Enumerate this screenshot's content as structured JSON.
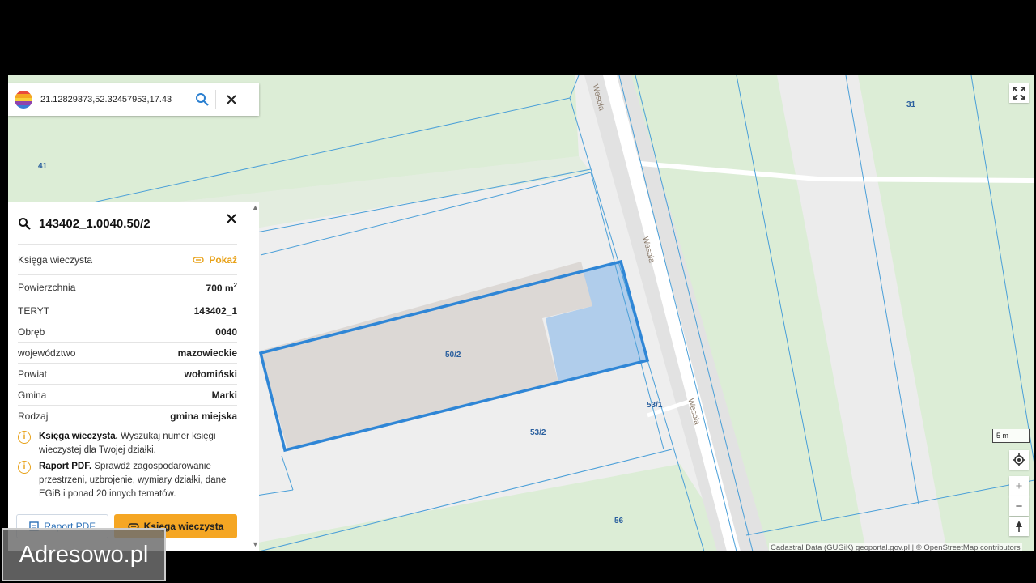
{
  "search": {
    "value": "21.12829373,52.32457953,17.43",
    "logo_icon": "adresowo-logo-icon",
    "search_icon": "search-icon",
    "clear_icon": "close-icon"
  },
  "panel": {
    "title": "143402_1.0040.50/2",
    "close_icon": "close-icon",
    "rows": [
      {
        "label": "Księga wieczysta",
        "value": "Pokaż",
        "is_link": true
      },
      {
        "label": "Powierzchnia",
        "value": "700 m",
        "sup": "2"
      },
      {
        "label": "TERYT",
        "value": "143402_1"
      },
      {
        "label": "Obręb",
        "value": "0040"
      },
      {
        "label": "województwo",
        "value": "mazowieckie"
      },
      {
        "label": "Powiat",
        "value": "wołomiński"
      },
      {
        "label": "Gmina",
        "value": "Marki"
      },
      {
        "label": "Rodzaj",
        "value": "gmina miejska"
      }
    ],
    "notes": [
      {
        "title": "Księga wieczysta.",
        "text": "Wyszukaj numer księgi wieczystej dla Twojej działki."
      },
      {
        "title": "Raport PDF.",
        "text": "Sprawdź zagospodarowanie przestrzeni, uzbrojenie, wymiary działki, dane EGiB i ponad 20 innych tematów."
      }
    ],
    "btn_report": "Raport PDF",
    "btn_kw": "Księga wieczysta"
  },
  "map": {
    "parcels": [
      "41",
      "31",
      "50/2",
      "53/1",
      "53/2",
      "56"
    ],
    "street": "Wesoła",
    "scale": "5 m",
    "attribution": "Cadastral Data (GUGiK) geoportal.gov.pl | © OpenStreetMap contributors",
    "colors": {
      "green": "#dcedd6",
      "road": "#ffffff",
      "parcel_line": "#4a9fd8",
      "selection": "#2f86d6",
      "selection_fill": "#a9c9ea",
      "building": "#dcd8d5"
    }
  },
  "controls": {
    "fullscreen_icon": "fullscreen-icon",
    "locate_icon": "locate-icon",
    "zoom_in": "+",
    "zoom_out": "−",
    "north_icon": "north-arrow-icon"
  },
  "watermark": "Adresowo.pl"
}
